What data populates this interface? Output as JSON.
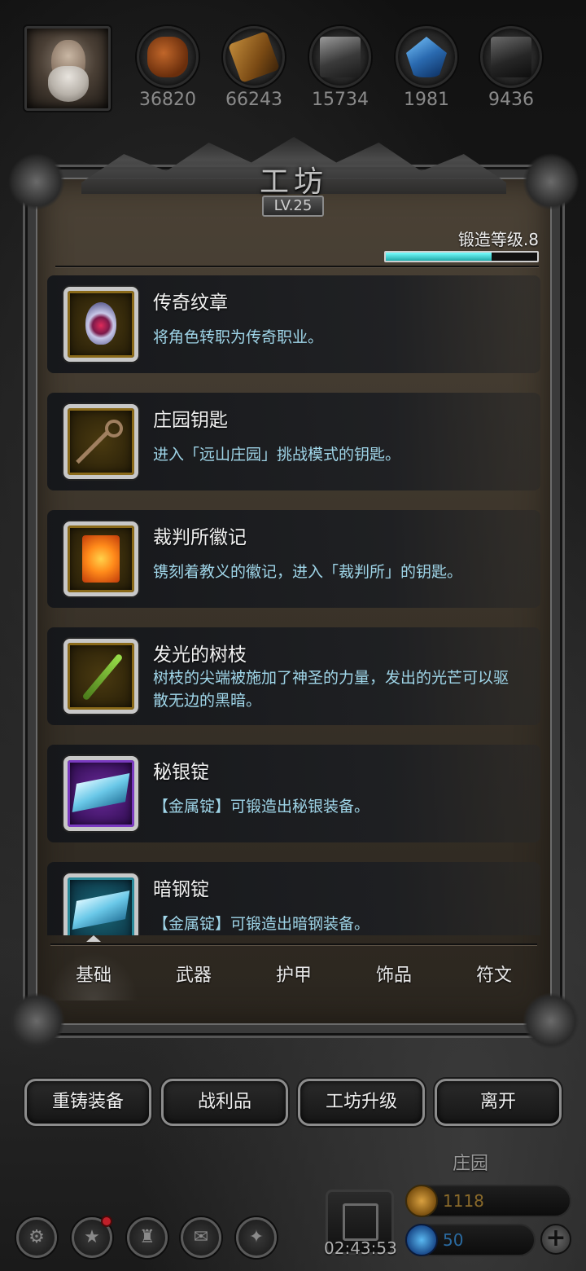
{
  "resources": [
    {
      "icon": "wood-logs-icon",
      "value": "36820",
      "color": "#8a4a1a"
    },
    {
      "icon": "lumber-planks-icon",
      "value": "66243",
      "color": "#9a6a2a"
    },
    {
      "icon": "iron-bars-icon",
      "value": "15734",
      "color": "#6a6a6a"
    },
    {
      "icon": "crystal-icon",
      "value": "1981",
      "color": "#2a7ac0"
    },
    {
      "icon": "steel-bars-icon",
      "value": "9436",
      "color": "#4a4a4a"
    }
  ],
  "workshop": {
    "title": "工坊",
    "level": "LV.25",
    "forge_label": "锻造等级.8",
    "forge_progress": 0.7
  },
  "items": [
    {
      "name": "传奇纹章",
      "desc": "将角色转职为传奇职业。",
      "icon": "legendary-emblem-icon",
      "frame": "gold"
    },
    {
      "name": "庄园钥匙",
      "desc": "进入「远山庄园」挑战模式的钥匙。",
      "icon": "key-icon",
      "frame": "gold"
    },
    {
      "name": "裁判所徽记",
      "desc": "镌刻着教义的徽记，进入「裁判所」的钥匙。",
      "icon": "inquisition-seal-icon",
      "frame": "gold"
    },
    {
      "name": "发光的树枝",
      "desc": "树枝的尖端被施加了神圣的力量，发出的光芒可以驱散无边的黑暗。",
      "icon": "glowing-branch-icon",
      "frame": "gold"
    },
    {
      "name": "秘银锭",
      "desc": "【金属锭】可锻造出秘银装备。",
      "icon": "mithril-ingot-icon",
      "frame": "purple"
    },
    {
      "name": "暗钢锭",
      "desc": "【金属锭】可锻造出暗钢装备。",
      "icon": "darksteel-ingot-icon",
      "frame": "teal"
    }
  ],
  "tabs": [
    "基础",
    "武器",
    "护甲",
    "饰品",
    "符文"
  ],
  "active_tab": 0,
  "actions": [
    "重铸装备",
    "战利品",
    "工坊升级",
    "离开"
  ],
  "bottom": {
    "estate_label": "庄园",
    "timer": "02:43:53",
    "currency_gold": "1118",
    "currency_gem": "50"
  },
  "colors": {
    "desc_text": "#9fd5e8",
    "forge_bar": "#4fd0d8",
    "gold_text": "#8a6a2a",
    "gem_text": "#2a6aa0"
  }
}
